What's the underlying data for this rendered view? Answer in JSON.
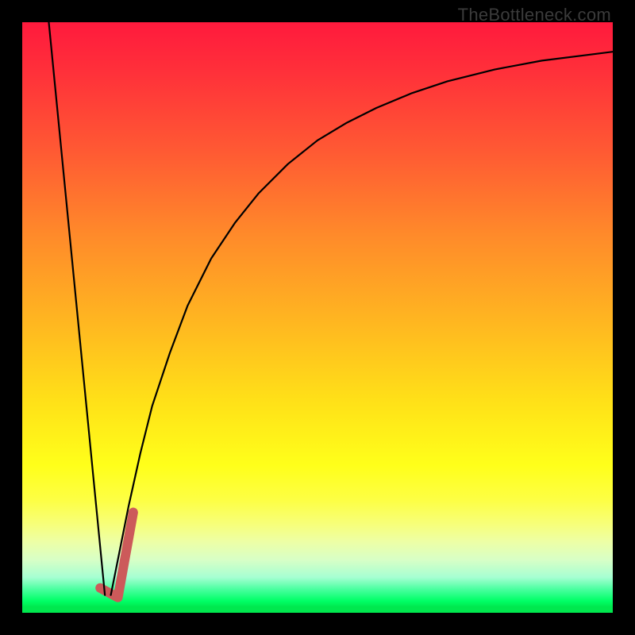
{
  "watermark": {
    "text": "TheBottleneck.com"
  },
  "chart_data": {
    "type": "line",
    "title": "",
    "xlabel": "",
    "ylabel": "",
    "xlim": [
      0,
      100
    ],
    "ylim": [
      0,
      100
    ],
    "grid": false,
    "legend": false,
    "series": [
      {
        "name": "left-line",
        "color": "#000000",
        "width": 2.2,
        "x": [
          4.5,
          14.0
        ],
        "y": [
          100,
          3
        ]
      },
      {
        "name": "right-curve",
        "color": "#000000",
        "width": 2.2,
        "x": [
          15,
          16,
          18,
          20,
          22,
          25,
          28,
          32,
          36,
          40,
          45,
          50,
          55,
          60,
          66,
          72,
          80,
          88,
          96,
          100
        ],
        "y": [
          3,
          8,
          18,
          27,
          35,
          44,
          52,
          60,
          66,
          71,
          76,
          80,
          83,
          85.5,
          88,
          90,
          92,
          93.5,
          94.5,
          95
        ]
      },
      {
        "name": "marker-tick",
        "color": "#cc5a5a",
        "width": 12,
        "x": [
          13.2,
          16.2,
          18.8
        ],
        "y": [
          4.2,
          2.6,
          17
        ]
      }
    ],
    "background_gradient": {
      "stops": [
        {
          "pos": 0,
          "color": "#ff1a3d"
        },
        {
          "pos": 8,
          "color": "#ff2f3a"
        },
        {
          "pos": 22,
          "color": "#ff5a33"
        },
        {
          "pos": 36,
          "color": "#ff8a2a"
        },
        {
          "pos": 50,
          "color": "#ffb421"
        },
        {
          "pos": 64,
          "color": "#ffe018"
        },
        {
          "pos": 75,
          "color": "#ffff1a"
        },
        {
          "pos": 81,
          "color": "#fdff45"
        },
        {
          "pos": 85,
          "color": "#f7ff7a"
        },
        {
          "pos": 88,
          "color": "#edffa6"
        },
        {
          "pos": 91,
          "color": "#d8ffc6"
        },
        {
          "pos": 94,
          "color": "#a6ffd2"
        },
        {
          "pos": 96,
          "color": "#4affa0"
        },
        {
          "pos": 98,
          "color": "#00ff66"
        },
        {
          "pos": 100,
          "color": "#00e84e"
        }
      ]
    }
  }
}
